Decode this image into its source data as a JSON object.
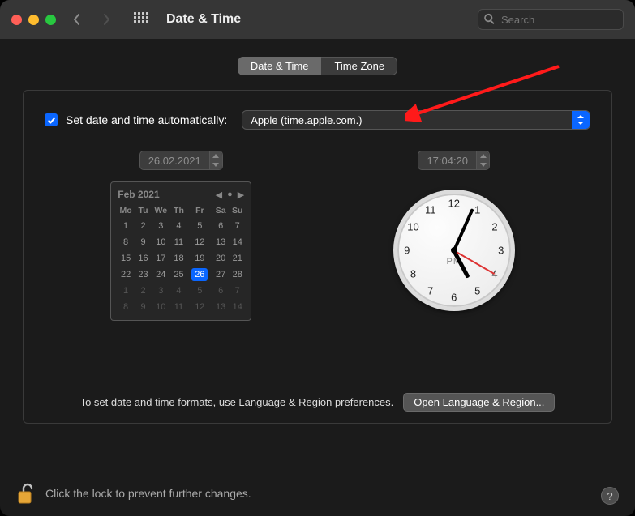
{
  "window": {
    "title": "Date & Time"
  },
  "search": {
    "placeholder": "Search"
  },
  "tabs": {
    "date_time": "Date & Time",
    "time_zone": "Time Zone",
    "active": "date_time"
  },
  "auto": {
    "label": "Set date and time automatically:",
    "checked": true,
    "server": "Apple (time.apple.com.)"
  },
  "date_field": {
    "value": "26.02.2021"
  },
  "time_field": {
    "value": "17:04:20"
  },
  "calendar": {
    "title": "Feb 2021",
    "weekdays": [
      "Mo",
      "Tu",
      "We",
      "Th",
      "Fr",
      "Sa",
      "Su"
    ],
    "grid": [
      [
        {
          "d": "1"
        },
        {
          "d": "2"
        },
        {
          "d": "3"
        },
        {
          "d": "4"
        },
        {
          "d": "5"
        },
        {
          "d": "6"
        },
        {
          "d": "7"
        }
      ],
      [
        {
          "d": "8"
        },
        {
          "d": "9"
        },
        {
          "d": "10"
        },
        {
          "d": "11"
        },
        {
          "d": "12"
        },
        {
          "d": "13"
        },
        {
          "d": "14"
        }
      ],
      [
        {
          "d": "15"
        },
        {
          "d": "16"
        },
        {
          "d": "17"
        },
        {
          "d": "18"
        },
        {
          "d": "19"
        },
        {
          "d": "20"
        },
        {
          "d": "21"
        }
      ],
      [
        {
          "d": "22"
        },
        {
          "d": "23"
        },
        {
          "d": "24"
        },
        {
          "d": "25"
        },
        {
          "d": "26",
          "today": true
        },
        {
          "d": "27"
        },
        {
          "d": "28"
        }
      ],
      [
        {
          "d": "1",
          "dim": true
        },
        {
          "d": "2",
          "dim": true
        },
        {
          "d": "3",
          "dim": true
        },
        {
          "d": "4",
          "dim": true
        },
        {
          "d": "5",
          "dim": true
        },
        {
          "d": "6",
          "dim": true
        },
        {
          "d": "7",
          "dim": true
        }
      ],
      [
        {
          "d": "8",
          "dim": true
        },
        {
          "d": "9",
          "dim": true
        },
        {
          "d": "10",
          "dim": true
        },
        {
          "d": "11",
          "dim": true
        },
        {
          "d": "12",
          "dim": true
        },
        {
          "d": "13",
          "dim": true
        },
        {
          "d": "14",
          "dim": true
        }
      ]
    ]
  },
  "clock": {
    "numbers": [
      "12",
      "1",
      "2",
      "3",
      "4",
      "5",
      "6",
      "7",
      "8",
      "9",
      "10",
      "11"
    ],
    "ampm": "PM",
    "hour": 17,
    "minute": 4,
    "second": 20
  },
  "formats": {
    "text": "To set date and time formats, use Language & Region preferences.",
    "button": "Open Language & Region..."
  },
  "lock": {
    "text": "Click the lock to prevent further changes."
  },
  "help": {
    "glyph": "?"
  }
}
